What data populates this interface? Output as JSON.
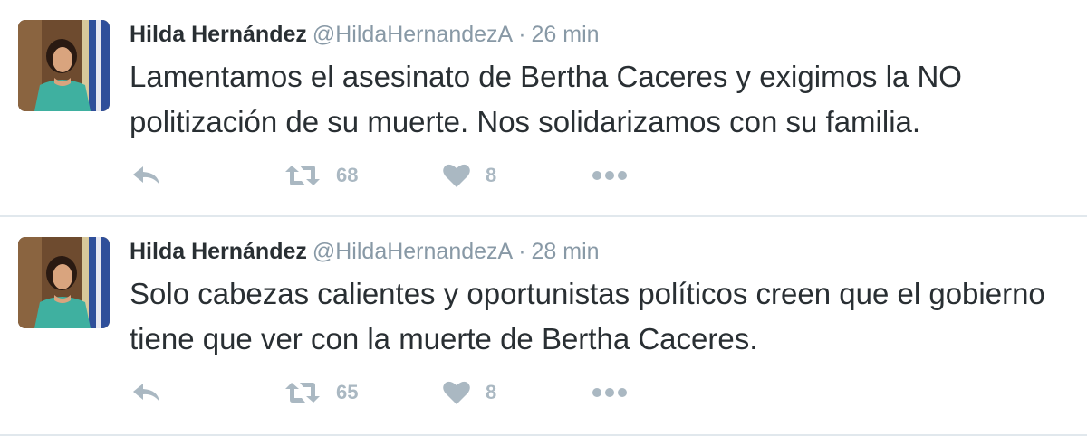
{
  "colors": {
    "name": "#292f33",
    "meta": "#8899a6",
    "action": "#aab8c2",
    "divider": "#e1e8ed"
  },
  "icons": {
    "reply": "reply-arrow-icon",
    "retweet": "retweet-icon",
    "like": "heart-icon",
    "more": "more-dots-icon"
  },
  "tweets": [
    {
      "name": "Hilda Hernández",
      "handle": "@HildaHernandezA",
      "sep": "·",
      "time": "26 min",
      "text": "Lamentamos el asesinato de Bertha Caceres y exigimos la NO politización de su muerte. Nos solidarizamos con su familia.",
      "retweets": "68",
      "likes": "8"
    },
    {
      "name": "Hilda Hernández",
      "handle": "@HildaHernandezA",
      "sep": "·",
      "time": "28 min",
      "text": "Solo cabezas calientes y oportunistas políticos creen que el gobierno tiene que ver con la muerte de Bertha Caceres.",
      "retweets": "65",
      "likes": "8"
    }
  ]
}
